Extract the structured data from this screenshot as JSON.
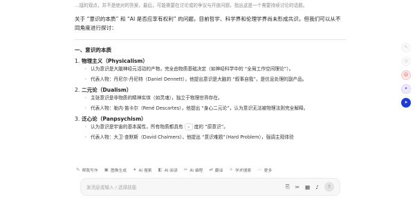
{
  "chat": {
    "faded_line": "…接的观点，并不是绝对的答案，最后，可能需要在讨论或的争议与开放问题，指出这是一个需要持续讨论的话题。",
    "intro": "关于 “意识的本质” 和 “AI 是否应享有权利” 的问题，目前哲学、科学界和伦理学界尚未形成共识，但我们可以从不同角度进行探讨：",
    "section_title": "一、意识的本质",
    "items": [
      {
        "num": "1.",
        "title": "物理主义（Physicalism）",
        "bullets": [
          "认为意识是大脑神经元活动的产物，完全由物质基础决定（如神经科学中的 “全局工作空间理论”）。",
          "代表人物：丹尼尔·丹尼特（Daniel Dennett），他提出意识是大脑的 “叙事自我”，是信息处理的副产品。"
        ]
      },
      {
        "num": "2.",
        "title": "二元论（Dualism）",
        "bullets": [
          "主张意识是非物质的精神实体（如灵魂），独立于物理世界存在。",
          "代表人物：勒内·笛卡尔（René Descartes），他提出 “身心二元论”，认为意识无法被物理法则完全解释。"
        ]
      },
      {
        "num": "3.",
        "title": "泛心论（Panpsychism）",
        "bullets": [
          "认为意识是宇宙的基本属性，所有物质都具有",
          "代表人物：大卫·查默斯（David Chalmers），他提出 “意识难题”（Hard Problem），强调主观体验"
        ],
        "bullet1_tail": "度的 “原意识”。"
      }
    ]
  },
  "toolbar": [
    {
      "icon": "✎",
      "label": "帮我写作",
      "name": "help-write"
    },
    {
      "icon": "▣",
      "label": "图像生成",
      "name": "image-gen"
    },
    {
      "icon": "✦",
      "label": "AI 搜索",
      "name": "ai-search"
    },
    {
      "icon": "◧",
      "label": "AI 阅读",
      "name": "ai-read"
    },
    {
      "icon": "✂",
      "label": "AI 编程",
      "name": "ai-code"
    },
    {
      "icon": "⇄",
      "label": "翻译",
      "name": "translate"
    },
    {
      "icon": "✧",
      "label": "学术搜索",
      "name": "academic-search"
    },
    {
      "icon": "⋯",
      "label": "更多",
      "name": "more"
    }
  ],
  "input": {
    "placeholder": "发消息或输入 / 选择技能"
  },
  "side_icons": [
    "compose-icon",
    "clock-icon",
    "robot-icon",
    "sparkle-icon",
    "arrow-icon"
  ]
}
